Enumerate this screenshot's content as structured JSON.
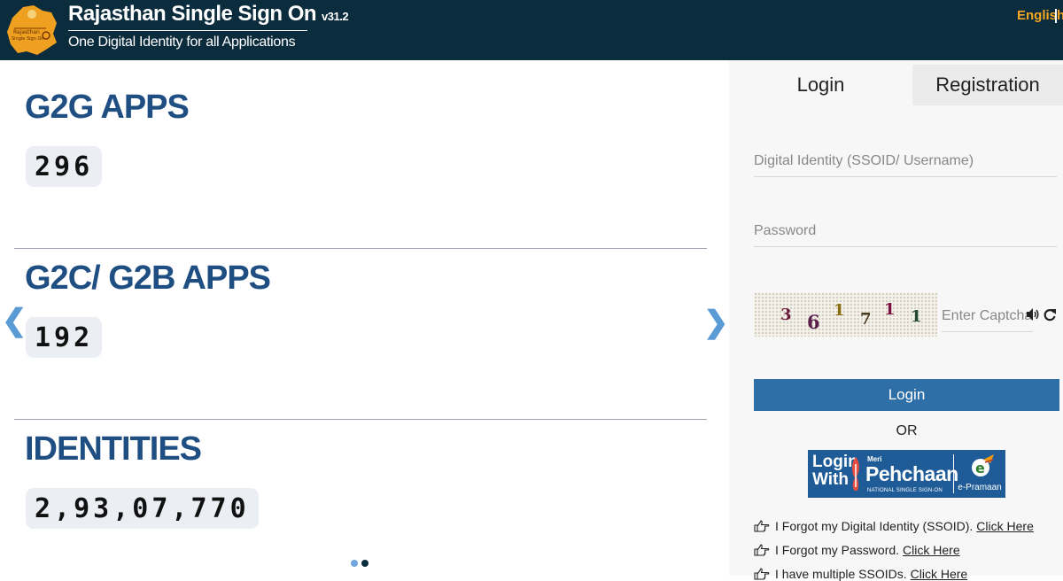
{
  "header": {
    "logo_text": "Rajasthan Single Sign On",
    "title": "Rajasthan Single Sign On",
    "version": "v31.2",
    "subtitle": "One Digital Identity for all Applications",
    "language": "English"
  },
  "stats": [
    {
      "title": "G2G APPS",
      "count": "296"
    },
    {
      "title": "G2C/ G2B APPS",
      "count": "192"
    },
    {
      "title": "IDENTITIES",
      "count": "2,93,07,770"
    }
  ],
  "carousel": {
    "active_dot": 1,
    "dot_count": 2
  },
  "tabs": {
    "login": "Login",
    "registration": "Registration"
  },
  "form": {
    "username_placeholder": "Digital Identity (SSOID/ Username)",
    "password_placeholder": "Password",
    "captcha_chars": [
      "3",
      "6",
      "1",
      "7",
      "1",
      "1"
    ],
    "captcha_placeholder": "Enter Captcha",
    "login_button": "Login",
    "or_text": "OR"
  },
  "pehchaan": {
    "login": "Login",
    "with": "With",
    "meri": "Meri",
    "brand": "Pehchaan",
    "tagline": "NATIONAL SINGLE SIGN-ON",
    "epramaan": "e-Pramaan"
  },
  "links": [
    {
      "text": "I Forgot my Digital Identity (SSOID).",
      "link": "Click Here"
    },
    {
      "text": "I Forgot my Password.",
      "link": "Click Here"
    },
    {
      "text": "I have multiple SSOIDs.",
      "link": "Click Here"
    }
  ],
  "colors": {
    "header_bg": "#0b2c3d",
    "accent_blue": "#1f4e82",
    "button_blue": "#2e6fa7",
    "language_orange": "#f5a623"
  }
}
